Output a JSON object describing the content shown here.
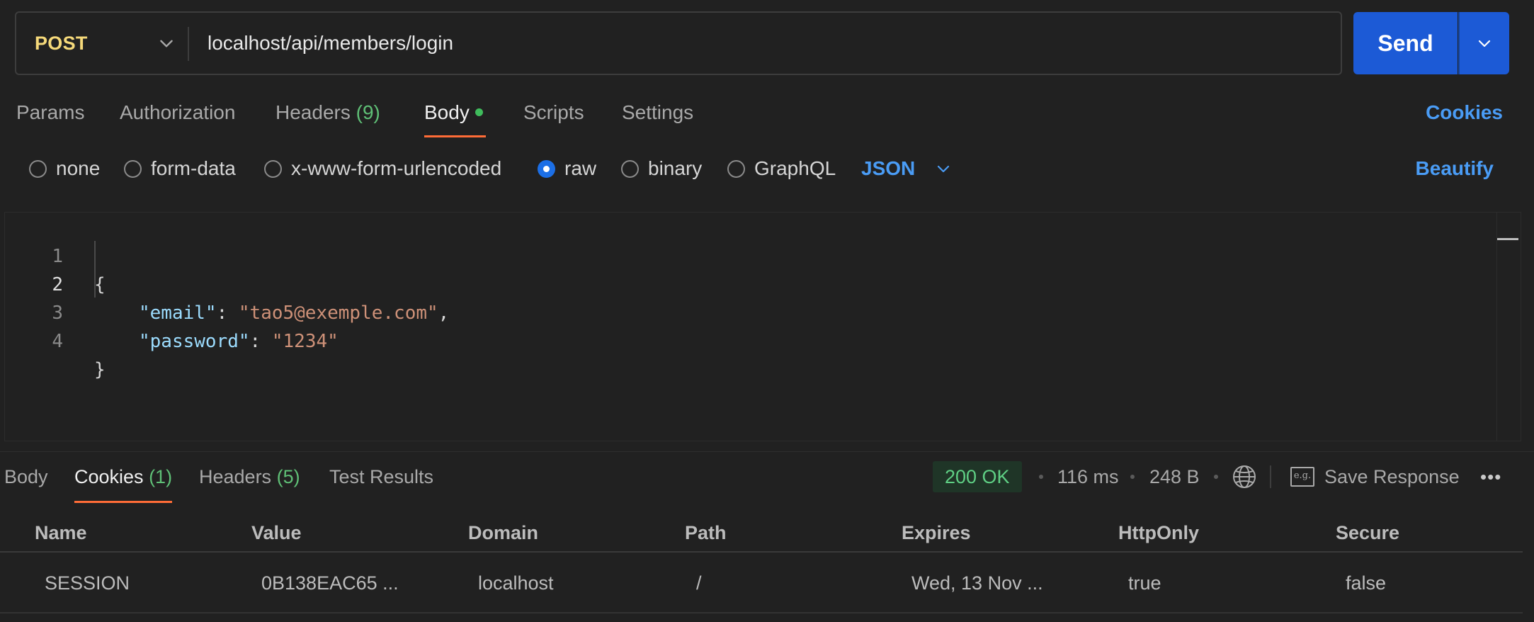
{
  "request": {
    "method": "POST",
    "url": "localhost/api/members/login",
    "send_label": "Send"
  },
  "request_tabs": [
    {
      "label": "Params"
    },
    {
      "label": "Authorization"
    },
    {
      "label": "Headers",
      "count": "(9)"
    },
    {
      "label": "Body",
      "active": true,
      "has_dot": true
    },
    {
      "label": "Scripts"
    },
    {
      "label": "Settings"
    }
  ],
  "cookies_link": "Cookies",
  "body_types": [
    {
      "label": "none",
      "selected": false
    },
    {
      "label": "form-data",
      "selected": false
    },
    {
      "label": "x-www-form-urlencoded",
      "selected": false
    },
    {
      "label": "raw",
      "selected": true
    },
    {
      "label": "binary",
      "selected": false
    },
    {
      "label": "GraphQL",
      "selected": false
    }
  ],
  "raw_language": "JSON",
  "beautify_label": "Beautify",
  "editor": {
    "line_numbers": [
      "1",
      "2",
      "3",
      "4"
    ],
    "open_brace": "{",
    "close_brace": "}",
    "email_key": "\"email\"",
    "email_value": "\"tao5@exemple.com\"",
    "password_key": "\"password\"",
    "password_value": "\"1234\"",
    "colon": ": ",
    "comma": ","
  },
  "response_tabs": [
    {
      "label": "Body"
    },
    {
      "label": "Cookies",
      "count": "(1)",
      "active": true
    },
    {
      "label": "Headers",
      "count": "(5)"
    },
    {
      "label": "Test Results"
    }
  ],
  "response_meta": {
    "status": "200 OK",
    "time": "116 ms",
    "size": "248 B",
    "save_label": "Save Response",
    "eg_label": "e.g.",
    "more": "•••"
  },
  "cookies_table": {
    "columns": [
      "Name",
      "Value",
      "Domain",
      "Path",
      "Expires",
      "HttpOnly",
      "Secure"
    ],
    "rows": [
      [
        "SESSION",
        "0B138EAC65 ...",
        "localhost",
        "/",
        "Wed, 13 Nov ...",
        "true",
        "false"
      ]
    ]
  },
  "colors": {
    "accent": "#1c5ad6",
    "method": "#f5d97a",
    "link": "#4a9cf5",
    "active_tab_underline": "#ff6c37",
    "success": "#5fcf84"
  }
}
